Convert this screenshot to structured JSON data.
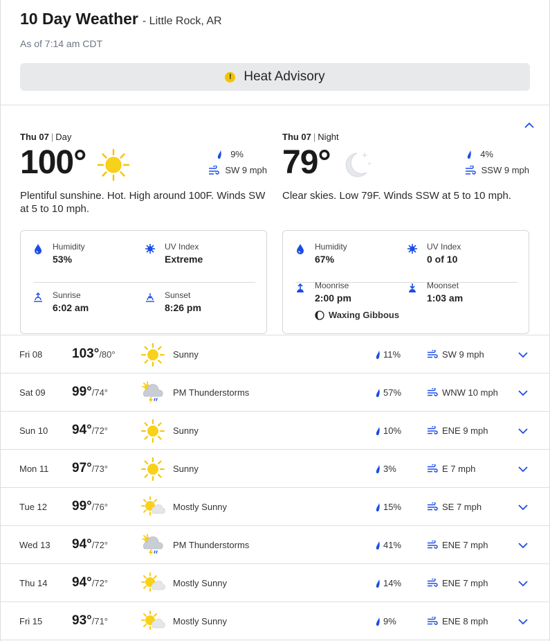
{
  "header": {
    "title": "10 Day Weather",
    "location": "- Little Rock, AR",
    "as_of": "As of 7:14 am CDT",
    "advisory": {
      "icon": "alert-icon",
      "label": "Heat Advisory"
    }
  },
  "today": {
    "day": {
      "date": "Thu 07",
      "period": "Day",
      "temp": "100°",
      "icon": "sun-icon",
      "precip": "9%",
      "wind": "SW 9 mph",
      "narrative": "Plentiful sunshine. Hot. High around 100F. Winds SW at 5 to 10 mph.",
      "humidity_label": "Humidity",
      "humidity": "53%",
      "uv_label": "UV Index",
      "uv": "Extreme",
      "sunrise_label": "Sunrise",
      "sunrise": "6:02 am",
      "sunset_label": "Sunset",
      "sunset": "8:26 pm"
    },
    "night": {
      "date": "Thu 07",
      "period": "Night",
      "temp": "79°",
      "icon": "moon-icon",
      "precip": "4%",
      "wind": "SSW 9 mph",
      "narrative": "Clear skies. Low 79F. Winds SSW at 5 to 10 mph.",
      "humidity_label": "Humidity",
      "humidity": "67%",
      "uv_label": "UV Index",
      "uv": "0 of 10",
      "moonrise_label": "Moonrise",
      "moonrise": "2:00 pm",
      "moonset_label": "Moonset",
      "moonset": "1:03 am",
      "moon_phase": "Waxing Gibbous"
    }
  },
  "forecast": [
    {
      "date": "Fri 08",
      "hi": "103°",
      "lo": "/80°",
      "icon": "sunny-icon",
      "condition": "Sunny",
      "precip": "11%",
      "wind": "SW 9 mph"
    },
    {
      "date": "Sat 09",
      "hi": "99°",
      "lo": "/74°",
      "icon": "thunderstorm-icon",
      "condition": "PM Thunderstorms",
      "precip": "57%",
      "wind": "WNW 10 mph"
    },
    {
      "date": "Sun 10",
      "hi": "94°",
      "lo": "/72°",
      "icon": "sunny-icon",
      "condition": "Sunny",
      "precip": "10%",
      "wind": "ENE 9 mph"
    },
    {
      "date": "Mon 11",
      "hi": "97°",
      "lo": "/73°",
      "icon": "sunny-icon",
      "condition": "Sunny",
      "precip": "3%",
      "wind": "E 7 mph"
    },
    {
      "date": "Tue 12",
      "hi": "99°",
      "lo": "/76°",
      "icon": "mostly-sunny-icon",
      "condition": "Mostly Sunny",
      "precip": "15%",
      "wind": "SE 7 mph"
    },
    {
      "date": "Wed 13",
      "hi": "94°",
      "lo": "/72°",
      "icon": "thunderstorm-icon",
      "condition": "PM Thunderstorms",
      "precip": "41%",
      "wind": "ENE 7 mph"
    },
    {
      "date": "Thu 14",
      "hi": "94°",
      "lo": "/72°",
      "icon": "mostly-sunny-icon",
      "condition": "Mostly Sunny",
      "precip": "14%",
      "wind": "ENE 7 mph"
    },
    {
      "date": "Fri 15",
      "hi": "93°",
      "lo": "/71°",
      "icon": "mostly-sunny-icon",
      "condition": "Mostly Sunny",
      "precip": "9%",
      "wind": "ENE 8 mph"
    }
  ],
  "colors": {
    "accent": "#1b4de4",
    "sun": "#f5c400",
    "advisory": "#f2c400",
    "muted": "#6f7585"
  }
}
